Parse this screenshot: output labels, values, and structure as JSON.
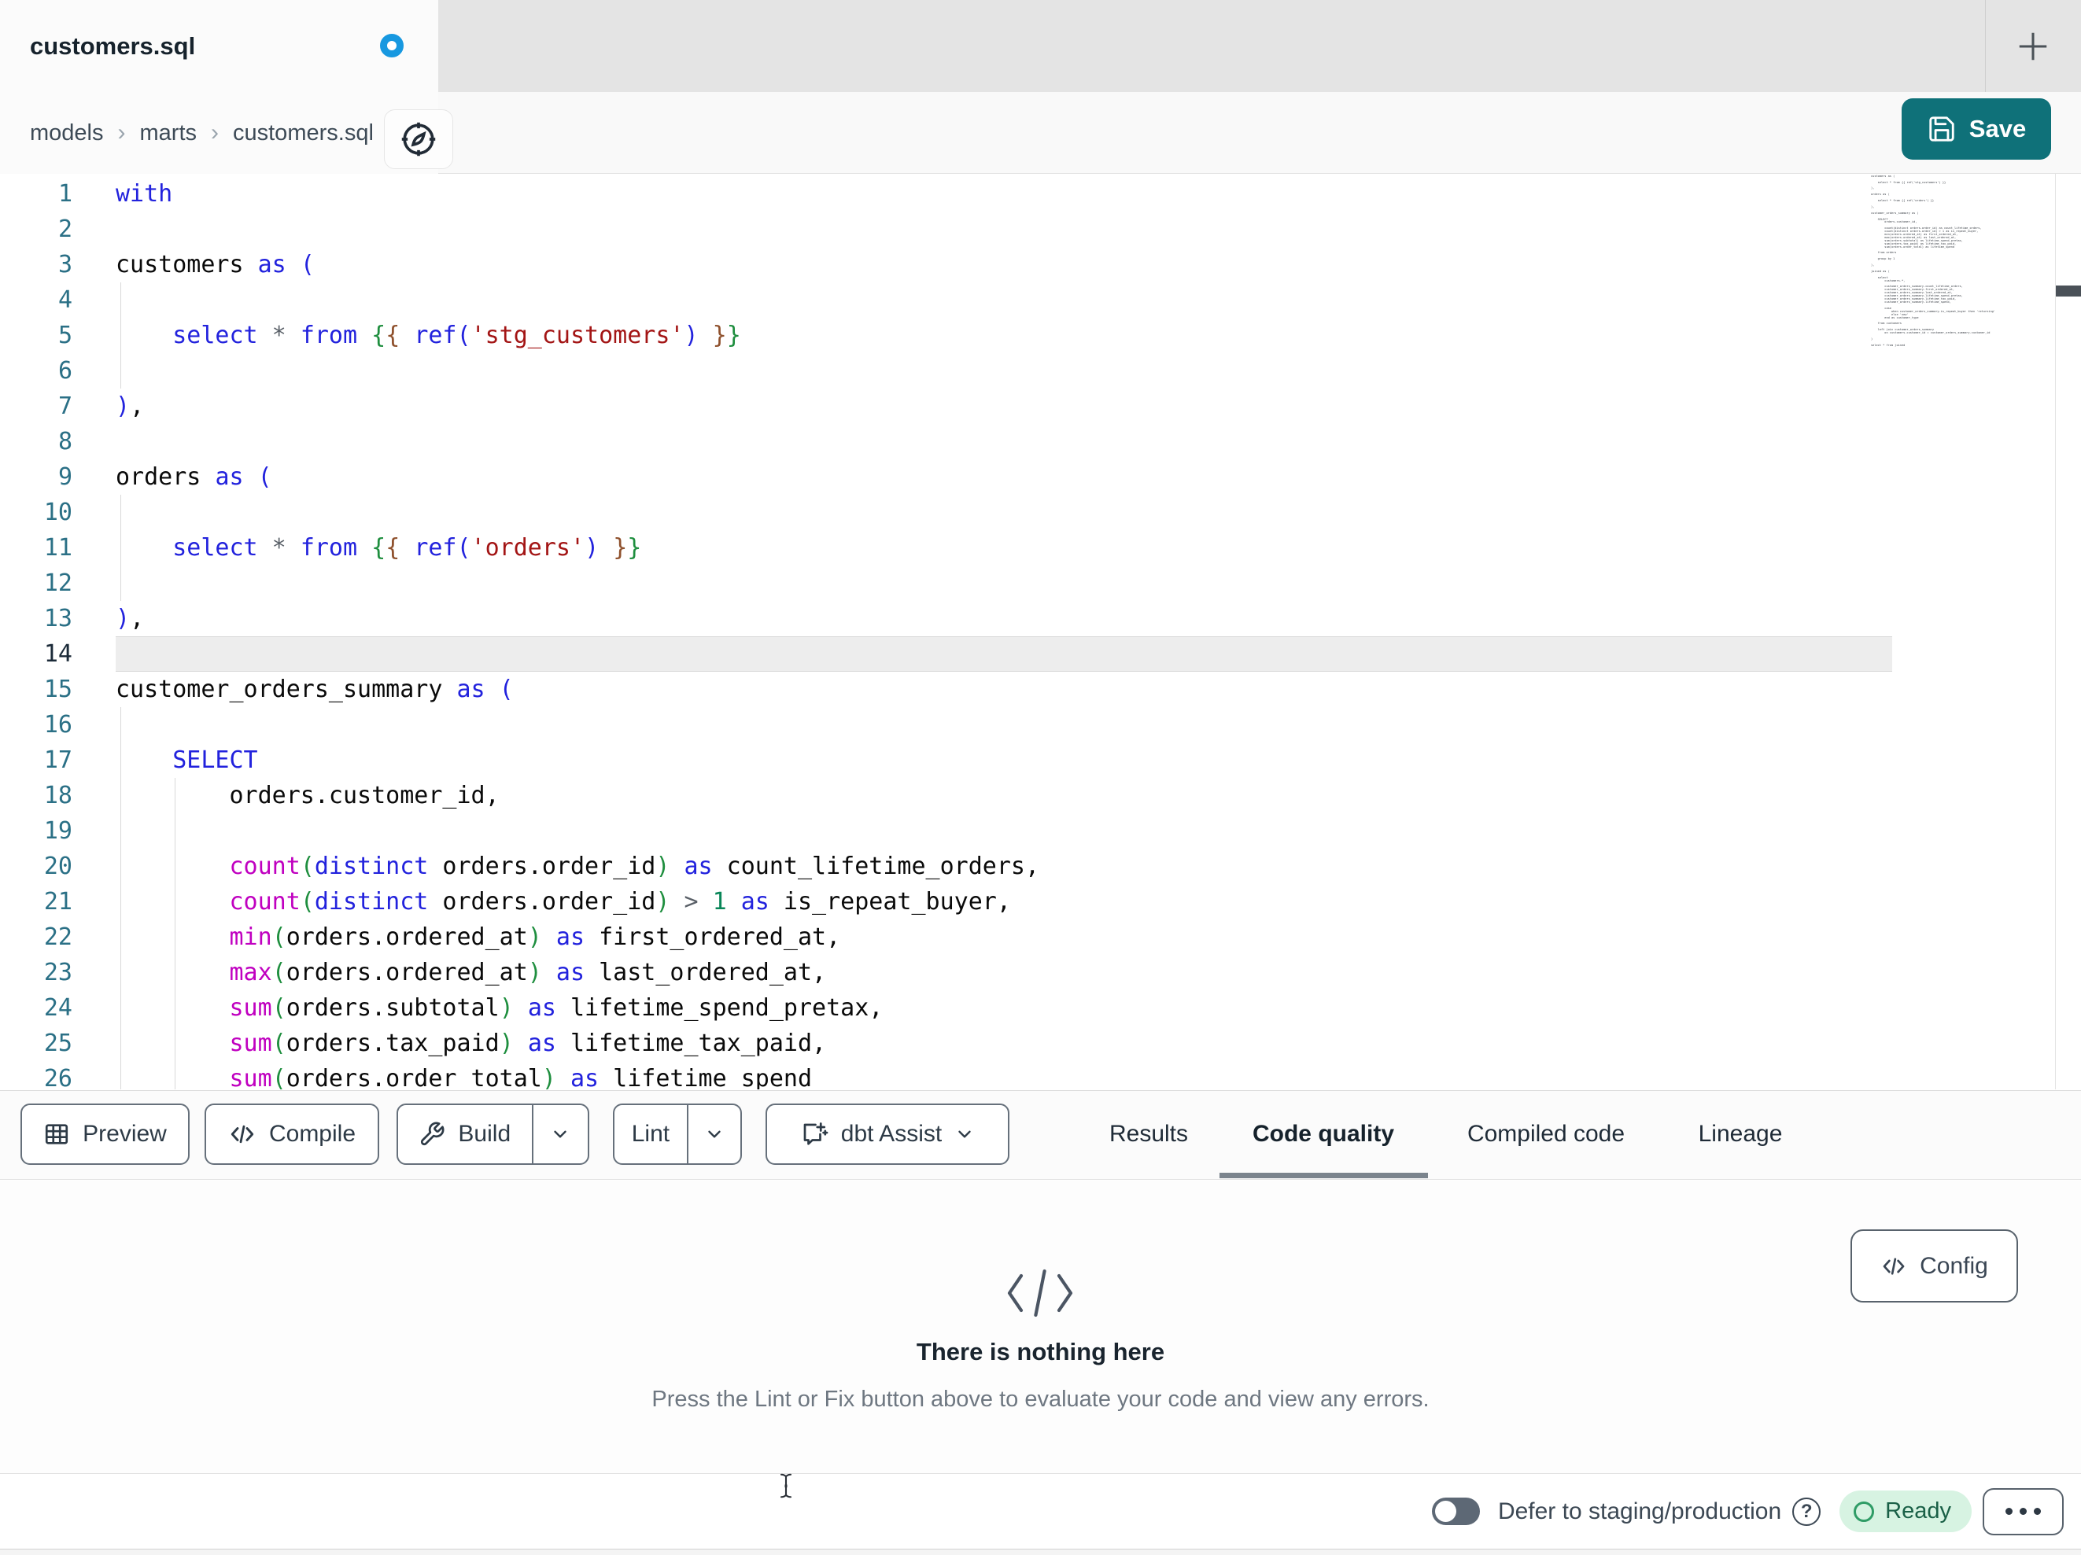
{
  "colors": {
    "accent_teal": "#0f7179",
    "tab_dot_blue": "#1798e0",
    "ready_bg": "#d7f3e2",
    "ready_text": "#1a6047",
    "toggle_off": "#5d6875",
    "tab_underline": "#7b848d",
    "syn_keyword": "#2222dd",
    "syn_function": "#c000c0",
    "syn_string": "#a31515",
    "syn_number": "#098658",
    "syn_operator": "#5a6068",
    "syn_bracket_1": "#2222dd",
    "syn_bracket_2": "#1e8e3e",
    "syn_bracket_3": "#8f512d",
    "line_number": "#2b7086",
    "line_number_active": "#1b2a38",
    "active_line_bg": "#ededed"
  },
  "tab_bar": {
    "active_tab_label": "customers.sql",
    "unsaved_indicator": "blue-dot"
  },
  "breadcrumb": {
    "items": [
      "models",
      "marts",
      "customers.sql"
    ],
    "separator": "›"
  },
  "save": {
    "label": "Save"
  },
  "editor": {
    "active_line": 14,
    "lines": [
      {
        "n": "1",
        "t": [
          [
            "k",
            "with"
          ]
        ]
      },
      {
        "n": "2",
        "t": []
      },
      {
        "n": "3",
        "t": [
          [
            "p",
            "customers "
          ],
          [
            "k",
            "as"
          ],
          [
            "p",
            " "
          ],
          [
            "b1",
            "("
          ]
        ]
      },
      {
        "n": "4",
        "t": []
      },
      {
        "n": "5",
        "t": [
          [
            "p",
            "    "
          ],
          [
            "k",
            "select"
          ],
          [
            "o",
            " * "
          ],
          [
            "k",
            "from"
          ],
          [
            "p",
            " "
          ],
          [
            "bg",
            "{"
          ],
          [
            "bb",
            "{"
          ],
          [
            "p",
            " "
          ],
          [
            "k",
            "ref"
          ],
          [
            "b1",
            "("
          ],
          [
            "s",
            "'stg_customers'"
          ],
          [
            "b1",
            ")"
          ],
          [
            "p",
            " "
          ],
          [
            "bb",
            "}"
          ],
          [
            "bg",
            "}"
          ]
        ]
      },
      {
        "n": "6",
        "t": []
      },
      {
        "n": "7",
        "t": [
          [
            "b1",
            ")"
          ],
          [
            "p",
            ","
          ]
        ]
      },
      {
        "n": "8",
        "t": []
      },
      {
        "n": "9",
        "t": [
          [
            "p",
            "orders "
          ],
          [
            "k",
            "as"
          ],
          [
            "p",
            " "
          ],
          [
            "b1",
            "("
          ]
        ]
      },
      {
        "n": "10",
        "t": []
      },
      {
        "n": "11",
        "t": [
          [
            "p",
            "    "
          ],
          [
            "k",
            "select"
          ],
          [
            "o",
            " * "
          ],
          [
            "k",
            "from"
          ],
          [
            "p",
            " "
          ],
          [
            "bg",
            "{"
          ],
          [
            "bb",
            "{"
          ],
          [
            "p",
            " "
          ],
          [
            "k",
            "ref"
          ],
          [
            "b1",
            "("
          ],
          [
            "s",
            "'orders'"
          ],
          [
            "b1",
            ")"
          ],
          [
            "p",
            " "
          ],
          [
            "bb",
            "}"
          ],
          [
            "bg",
            "}"
          ]
        ]
      },
      {
        "n": "12",
        "t": []
      },
      {
        "n": "13",
        "t": [
          [
            "b1",
            ")"
          ],
          [
            "p",
            ","
          ]
        ]
      },
      {
        "n": "14",
        "t": []
      },
      {
        "n": "15",
        "t": [
          [
            "p",
            "customer_orders_summary "
          ],
          [
            "k",
            "as"
          ],
          [
            "p",
            " "
          ],
          [
            "b1",
            "("
          ]
        ]
      },
      {
        "n": "16",
        "t": []
      },
      {
        "n": "17",
        "t": [
          [
            "p",
            "    "
          ],
          [
            "k",
            "SELECT"
          ]
        ]
      },
      {
        "n": "18",
        "t": [
          [
            "p",
            "        orders.customer_id,"
          ]
        ]
      },
      {
        "n": "19",
        "t": []
      },
      {
        "n": "20",
        "t": [
          [
            "p",
            "        "
          ],
          [
            "f",
            "count"
          ],
          [
            "bg",
            "("
          ],
          [
            "k",
            "distinct"
          ],
          [
            "p",
            " orders.order_id"
          ],
          [
            "bg",
            ")"
          ],
          [
            "p",
            " "
          ],
          [
            "k",
            "as"
          ],
          [
            "p",
            " count_lifetime_orders,"
          ]
        ]
      },
      {
        "n": "21",
        "t": [
          [
            "p",
            "        "
          ],
          [
            "f",
            "count"
          ],
          [
            "bg",
            "("
          ],
          [
            "k",
            "distinct"
          ],
          [
            "p",
            " orders.order_id"
          ],
          [
            "bg",
            ")"
          ],
          [
            "o",
            " > "
          ],
          [
            "n",
            "1"
          ],
          [
            "p",
            " "
          ],
          [
            "k",
            "as"
          ],
          [
            "p",
            " is_repeat_buyer,"
          ]
        ]
      },
      {
        "n": "22",
        "t": [
          [
            "p",
            "        "
          ],
          [
            "f",
            "min"
          ],
          [
            "bg",
            "("
          ],
          [
            "p",
            "orders.ordered_at"
          ],
          [
            "bg",
            ")"
          ],
          [
            "p",
            " "
          ],
          [
            "k",
            "as"
          ],
          [
            "p",
            " first_ordered_at,"
          ]
        ]
      },
      {
        "n": "23",
        "t": [
          [
            "p",
            "        "
          ],
          [
            "f",
            "max"
          ],
          [
            "bg",
            "("
          ],
          [
            "p",
            "orders.ordered_at"
          ],
          [
            "bg",
            ")"
          ],
          [
            "p",
            " "
          ],
          [
            "k",
            "as"
          ],
          [
            "p",
            " last_ordered_at,"
          ]
        ]
      },
      {
        "n": "24",
        "t": [
          [
            "p",
            "        "
          ],
          [
            "f",
            "sum"
          ],
          [
            "bg",
            "("
          ],
          [
            "p",
            "orders.subtotal"
          ],
          [
            "bg",
            ")"
          ],
          [
            "p",
            " "
          ],
          [
            "k",
            "as"
          ],
          [
            "p",
            " lifetime_spend_pretax,"
          ]
        ]
      },
      {
        "n": "25",
        "t": [
          [
            "p",
            "        "
          ],
          [
            "f",
            "sum"
          ],
          [
            "bg",
            "("
          ],
          [
            "p",
            "orders.tax_paid"
          ],
          [
            "bg",
            ")"
          ],
          [
            "p",
            " "
          ],
          [
            "k",
            "as"
          ],
          [
            "p",
            " lifetime_tax_paid,"
          ]
        ]
      },
      {
        "n": "26",
        "t": [
          [
            "p",
            "        "
          ],
          [
            "f",
            "sum"
          ],
          [
            "bg",
            "("
          ],
          [
            "p",
            "orders.order_total"
          ],
          [
            "bg",
            ")"
          ],
          [
            "p",
            " "
          ],
          [
            "k",
            "as"
          ],
          [
            "p",
            " lifetime_spend"
          ]
        ]
      }
    ]
  },
  "minimap": {
    "code": "with\n\ncustomers as (\n\n    select * from {{ ref('stg_customers') }}\n\n),\n\norders as (\n\n    select * from {{ ref('orders') }}\n\n),\n\ncustomer_orders_summary as (\n\n    SELECT\n        orders.customer_id,\n\n        count(distinct orders.order_id) as count_lifetime_orders,\n        count(distinct orders.order_id) > 1 as is_repeat_buyer,\n        min(orders.ordered_at) as first_ordered_at,\n        max(orders.ordered_at) as last_ordered_at,\n        sum(orders.subtotal) as lifetime_spend_pretax,\n        sum(orders.tax_paid) as lifetime_tax_paid,\n        sum(orders.order_total) as lifetime_spend\n\n    from orders\n\n    group by 1\n\n),\n\njoined as (\n\n    select\n        customers.*,\n\n        customer_orders_summary.count_lifetime_orders,\n        customer_orders_summary.first_ordered_at,\n        customer_orders_summary.last_ordered_at,\n        customer_orders_summary.lifetime_spend_pretax,\n        customer_orders_summary.lifetime_tax_paid,\n        customer_orders_summary.lifetime_spend,\n\n        case\n            when customer_orders_summary.is_repeat_buyer then 'returning'\n            else 'new'\n        end as customer_type\n\n    from customers\n\n    left join customer_orders_summary\n        on customers.customer_id = customer_orders_summary.customer_id\n\n)\n\nselect * from joined"
  },
  "toolbar": {
    "preview_label": "Preview",
    "compile_label": "Compile",
    "build_label": "Build",
    "lint_label": "Lint",
    "assist_label": "dbt Assist"
  },
  "panel_tabs": {
    "items": [
      "Results",
      "Code quality",
      "Compiled code",
      "Lineage"
    ],
    "active": "Code quality"
  },
  "empty_state": {
    "title": "There is nothing here",
    "description": "Press the Lint or Fix button above to evaluate your code and view any errors."
  },
  "config": {
    "label": "Config"
  },
  "status_bar": {
    "defer_label": "Defer to staging/production",
    "help_glyph": "?",
    "ready_label": "Ready"
  }
}
